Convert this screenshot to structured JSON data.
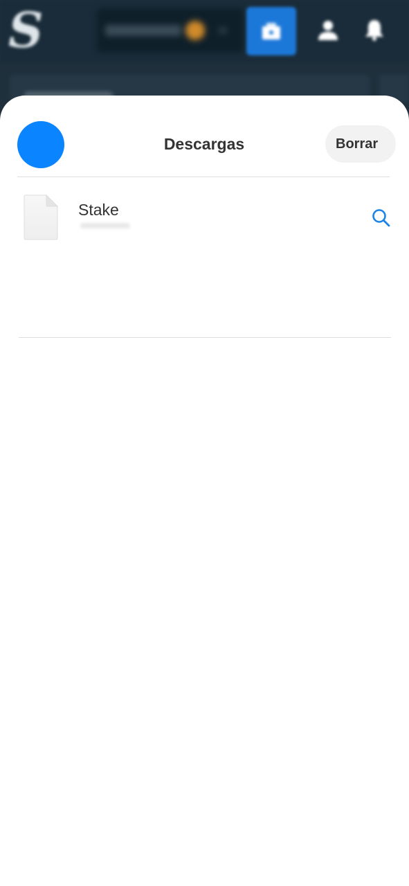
{
  "background_app": {
    "logo": "S",
    "colors": {
      "bar": "#1a2c39",
      "wallet_button": "#1c78d8"
    },
    "icons": [
      "wallet-icon",
      "user-icon",
      "bell-icon"
    ]
  },
  "sheet": {
    "title": "Descargas",
    "clear_label": "Borrar",
    "avatar_color": "#0a84ff"
  },
  "downloads": [
    {
      "name": "Stake",
      "icon": "file-icon",
      "action_icon": "search-icon"
    }
  ]
}
